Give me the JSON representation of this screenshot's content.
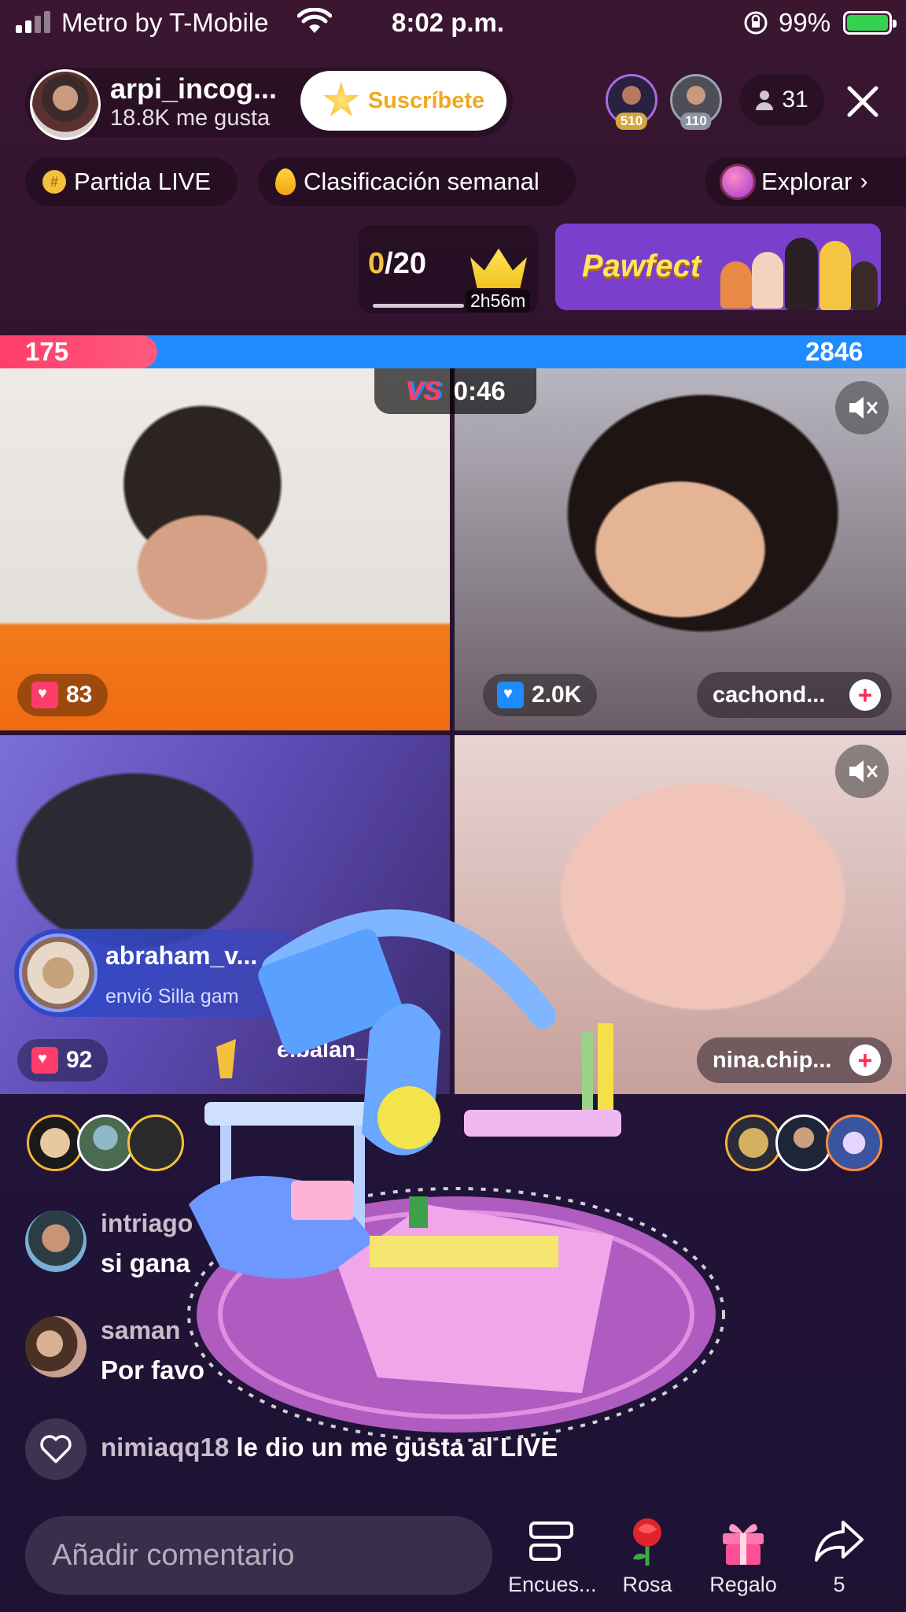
{
  "status_bar": {
    "carrier": "Metro by T-Mobile",
    "time": "8:02 p.m.",
    "battery": "99%"
  },
  "host": {
    "name": "arpi_incog...",
    "likes": "18.8K me gusta",
    "subscribe_label": "Suscríbete"
  },
  "viewers": {
    "top1_score": "510",
    "top2_score": "110",
    "count": "31"
  },
  "chips": {
    "partida": "Partida LIVE",
    "ranking": "Clasificación semanal",
    "explore": "Explorar"
  },
  "goal": {
    "current": "0",
    "total": "/20",
    "timer": "2h56m"
  },
  "banner": {
    "text": "Pawfect"
  },
  "battle": {
    "left_score": "175",
    "right_score": "2846",
    "timer": "0:46",
    "left_fraction": 0.058
  },
  "tiles": {
    "t1_gifts": "83",
    "t2_gifts": "2.0K",
    "t2_name": "cachond...",
    "t3_gifts": "92",
    "t3_name": "elbalan_",
    "t4_name": "nina.chip..."
  },
  "gift_notice": {
    "sender": "abraham_v...",
    "desc": "envió Silla gam"
  },
  "comments": [
    {
      "user": "intriago",
      "text": "si gana"
    },
    {
      "user": "saman",
      "text": "Por favo"
    }
  ],
  "like_notice": {
    "user": "nimiaqq18",
    "text": " le dio un me gusta al LIVE"
  },
  "bottom_bar": {
    "comment_placeholder": "Añadir comentario",
    "poll": "Encues...",
    "rose": "Rosa",
    "gift": "Regalo",
    "share": "5"
  },
  "icons": {
    "signal": "signal-icon",
    "wifi": "wifi-icon",
    "battery": "battery-icon",
    "close": "close-icon",
    "person": "person-icon",
    "mute": "mute-icon",
    "heart": "heart-icon",
    "share": "share-icon"
  },
  "colors": {
    "red_team": "#ff3d6b",
    "blue_team": "#1e8cff",
    "accent": "#fe2c55"
  }
}
